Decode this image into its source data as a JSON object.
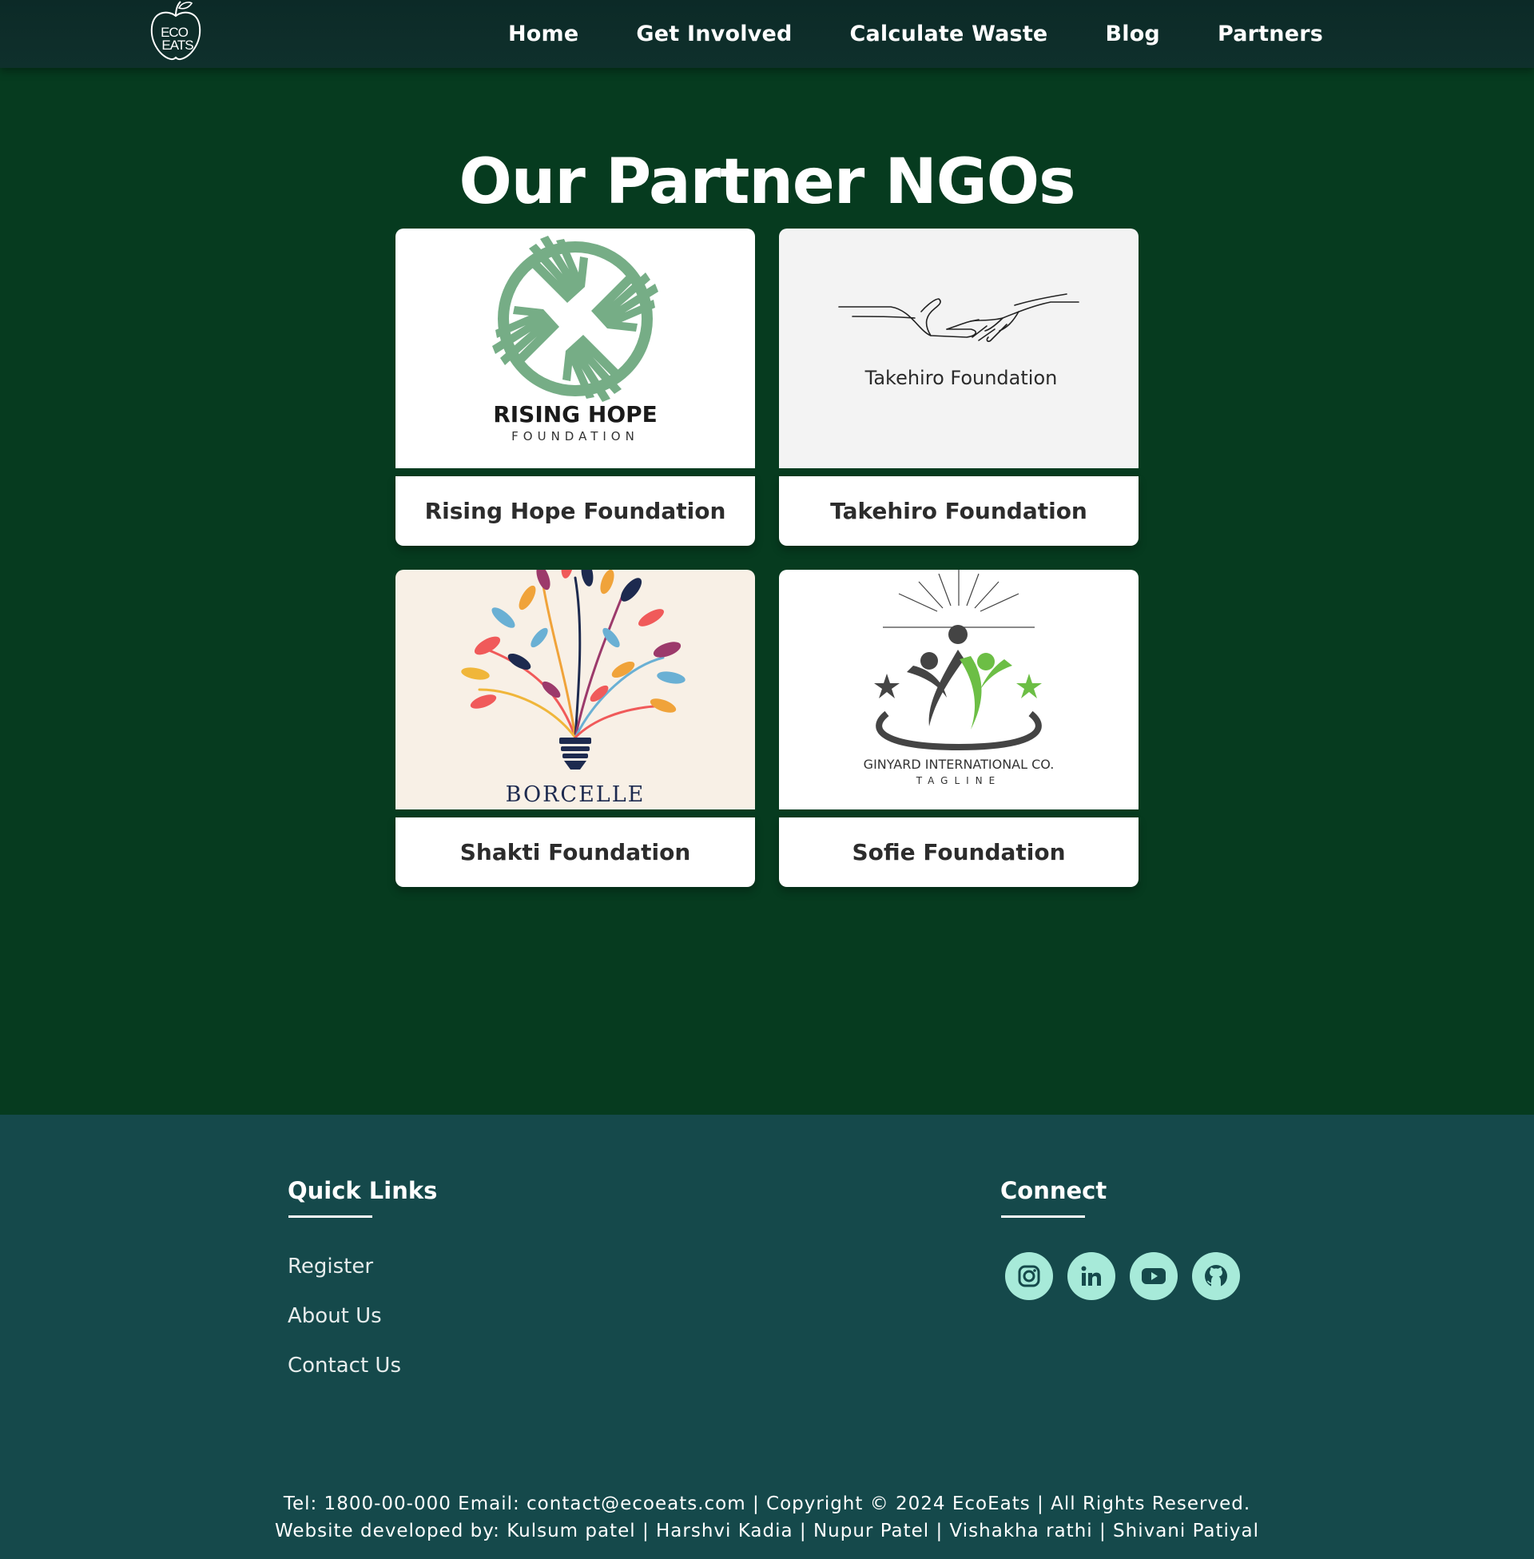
{
  "nav": {
    "logo_text_top": "ECO",
    "logo_text_bottom": "EATS",
    "links": [
      "Home",
      "Get Involved",
      "Calculate Waste",
      "Blog",
      "Partners"
    ]
  },
  "main": {
    "title": "Our Partner NGOs",
    "ngos": [
      {
        "name": "Rising Hope Foundation",
        "logo_title": "RISING HOPE",
        "logo_subtitle": "FOUNDATION",
        "logo_icon": "hands-circle-icon"
      },
      {
        "name": "Takehiro Foundation",
        "logo_title": "Takehiro Foundation",
        "logo_icon": "hands-reaching-icon"
      },
      {
        "name": "Shakti Foundation",
        "logo_title": "BORCELLE",
        "logo_icon": "lightbulb-tree-icon"
      },
      {
        "name": "Sofie Foundation",
        "logo_title": "GINYARD INTERNATIONAL CO.",
        "logo_subtitle": "TAGLINE",
        "logo_icon": "people-stars-icon"
      }
    ]
  },
  "footer": {
    "quick_links_heading": "Quick Links",
    "quick_links": [
      "Register",
      "About Us",
      "Contact Us"
    ],
    "connect_heading": "Connect",
    "socials": [
      "instagram-icon",
      "linkedin-icon",
      "youtube-icon",
      "github-icon"
    ],
    "bottom_line1": "Tel: 1800-00-000 Email: contact@ecoeats.com | Copyright © 2024 EcoEats | All Rights Reserved.",
    "bottom_line2": "Website developed by: Kulsum patel | Harshvi Kadia | Nupur Patel | Vishakha rathi | Shivani Patiyal"
  },
  "colors": {
    "nav_bg": "#0c2a27",
    "main_bg": "#063b1f",
    "footer_bg": "#15494b",
    "social_bg": "#a7ead9",
    "rising_hope_green": "#76ad86",
    "sofie_green": "#6cbe45"
  }
}
